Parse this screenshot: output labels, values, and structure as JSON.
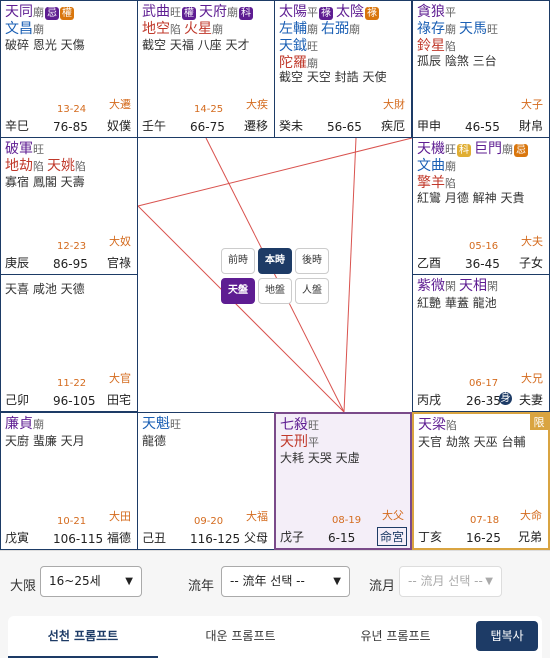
{
  "colors": {
    "main": "#5e1d92",
    "sub": "#1a5fb4",
    "bad": "#c0392b",
    "gold": "#d46b1e",
    "navy": "#1d3b66",
    "ke": "#e0ae33",
    "quan": "#d9760d",
    "lu": "#5e1d92",
    "ji": "#c0392b"
  },
  "palaces": [
    {
      "id": "si",
      "stars": [
        [
          {
            "n": "天同",
            "c": "main",
            "b": "廟",
            "badges": [
              [
                "忌",
                "lu"
              ],
              [
                "權",
                "quan"
              ]
            ]
          }
        ],
        [
          {
            "n": "文昌",
            "c": "sub",
            "b": "廟"
          }
        ]
      ],
      "minor": "破碎 恩光 天傷",
      "age": "13-24",
      "dlabel": "大遷",
      "ganzhi": "辛巳",
      "range": "76-85",
      "name": "奴僕"
    },
    {
      "id": "wu",
      "stars": [
        [
          {
            "n": "武曲",
            "c": "main",
            "b": "旺",
            "badges": [
              [
                "權",
                "lu"
              ]
            ]
          },
          {
            "n": "天府",
            "c": "main",
            "b": "廟",
            "badges": [
              [
                "科",
                "lu"
              ]
            ]
          }
        ],
        [
          {
            "n": "地空",
            "c": "bad",
            "b": "陷"
          },
          {
            "n": "火星",
            "c": "bad",
            "b": "廟"
          }
        ]
      ],
      "minor": "截空 天福 八座 天才",
      "age": "14-25",
      "dlabel": "大疾",
      "ganzhi": "壬午",
      "range": "66-75",
      "name": "遷移"
    },
    {
      "id": "wei",
      "stars": [
        [
          {
            "n": "太陽",
            "c": "main",
            "b": "平",
            "badges": [
              [
                "祿",
                "lu"
              ]
            ]
          },
          {
            "n": "太陰",
            "c": "main",
            "b": "",
            "badges": [
              [
                "祿",
                "quan"
              ]
            ]
          }
        ],
        [
          {
            "n": "左輔",
            "c": "sub",
            "b": "廟"
          },
          {
            "n": "右弼",
            "c": "sub",
            "b": "廟"
          }
        ],
        [
          {
            "n": "天鉞",
            "c": "sub",
            "b": "旺"
          }
        ],
        [
          {
            "n": "陀羅",
            "c": "bad",
            "b": "廟"
          }
        ]
      ],
      "minor": "截空 天空 封誥 天使",
      "age": "",
      "dlabel": "大財",
      "ganzhi": "癸未",
      "range": "56-65",
      "name": "疾厄"
    },
    {
      "id": "shen",
      "stars": [
        [
          {
            "n": "貪狼",
            "c": "main",
            "b": "平"
          }
        ],
        [
          {
            "n": "祿存",
            "c": "sub",
            "b": "廟"
          },
          {
            "n": "天馬",
            "c": "sub",
            "b": "旺"
          }
        ],
        [
          {
            "n": "鈴星",
            "c": "bad",
            "b": "陷"
          }
        ]
      ],
      "minor": "孤辰 陰煞 三台",
      "age": "",
      "dlabel": "大子",
      "ganzhi": "甲申",
      "range": "46-55",
      "name": "財帛"
    },
    {
      "id": "chen",
      "stars": [
        [
          {
            "n": "破軍",
            "c": "main",
            "b": "旺"
          }
        ],
        [
          {
            "n": "地劫",
            "c": "bad",
            "b": "陷"
          },
          {
            "n": "天姚",
            "c": "bad",
            "b": "陷"
          }
        ]
      ],
      "minor": "寡宿 鳳閣 天壽",
      "age": "12-23",
      "dlabel": "大奴",
      "ganzhi": "庚辰",
      "range": "86-95",
      "name": "官祿"
    },
    {
      "id": "you",
      "stars": [
        [
          {
            "n": "天機",
            "c": "main",
            "b": "旺",
            "badges": [
              [
                "科",
                "ke"
              ]
            ]
          },
          {
            "n": "巨門",
            "c": "main",
            "b": "廟",
            "badges": [
              [
                "忌",
                "quan"
              ]
            ]
          }
        ],
        [
          {
            "n": "文曲",
            "c": "sub",
            "b": "廟"
          }
        ],
        [
          {
            "n": "擎羊",
            "c": "bad",
            "b": "陷"
          }
        ]
      ],
      "minor": "紅鸞 月德 解神 天貴",
      "age": "05-16",
      "dlabel": "大夫",
      "ganzhi": "乙酉",
      "range": "36-45",
      "name": "子女"
    },
    {
      "id": "mao",
      "stars": [
        []
      ],
      "minor": "天喜 咸池 天德",
      "age": "11-22",
      "dlabel": "大官",
      "ganzhi": "己卯",
      "range": "96-105",
      "name": "田宅"
    },
    {
      "id": "xu",
      "stars": [
        [
          {
            "n": "紫微",
            "c": "main",
            "b": "閑"
          },
          {
            "n": "天相",
            "c": "main",
            "b": "閑"
          }
        ]
      ],
      "minor": "紅艷 華蓋 龍池",
      "age": "06-17",
      "dlabel": "大兄",
      "ganzhi": "丙戌",
      "range": "26-35",
      "name": "夫妻",
      "shen": "身"
    },
    {
      "id": "yin",
      "stars": [
        [
          {
            "n": "廉貞",
            "c": "main",
            "b": "廟"
          }
        ]
      ],
      "minor": "天廚 蜚廉 天月",
      "age": "10-21",
      "dlabel": "大田",
      "ganzhi": "戊寅",
      "range": "106-115",
      "name": "福德"
    },
    {
      "id": "chou",
      "stars": [
        [
          {
            "n": "天魁",
            "c": "sub",
            "b": "旺"
          }
        ]
      ],
      "minor": "龍德",
      "age": "09-20",
      "dlabel": "大福",
      "ganzhi": "己丑",
      "range": "116-125",
      "name": "父母"
    },
    {
      "id": "zi",
      "stars": [
        [
          {
            "n": "七殺",
            "c": "main",
            "b": "旺"
          }
        ],
        [
          {
            "n": "天刑",
            "c": "bad",
            "b": "平"
          }
        ]
      ],
      "minor": "大耗 天哭 天虛",
      "age": "08-19",
      "dlabel": "大父",
      "ganzhi": "戊子",
      "range": "6-15",
      "name": "命宮"
    },
    {
      "id": "hai",
      "stars": [
        [
          {
            "n": "天梁",
            "c": "main",
            "b": "陷"
          }
        ]
      ],
      "minor": "天官 劫煞 天巫 台輔",
      "age": "07-18",
      "dlabel": "大命",
      "ganzhi": "丁亥",
      "range": "16-25",
      "name": "兄弟",
      "corner": "限"
    }
  ],
  "center": {
    "row1": [
      "前時",
      "本時",
      "後時"
    ],
    "row2": [
      "天盤",
      "地盤",
      "人盤"
    ]
  },
  "controls": {
    "daxian_label": "大限",
    "daxian_value": "16~25세",
    "liunian_label": "流年",
    "liunian_value": "-- 流年 선택 --",
    "liuyue_label": "流月",
    "liuyue_value": "-- 流月 선택 --"
  },
  "tabs": [
    "선천 프롬프트",
    "대운 프롬프트",
    "유년 프롬프트"
  ],
  "copy_label": "탭복사"
}
